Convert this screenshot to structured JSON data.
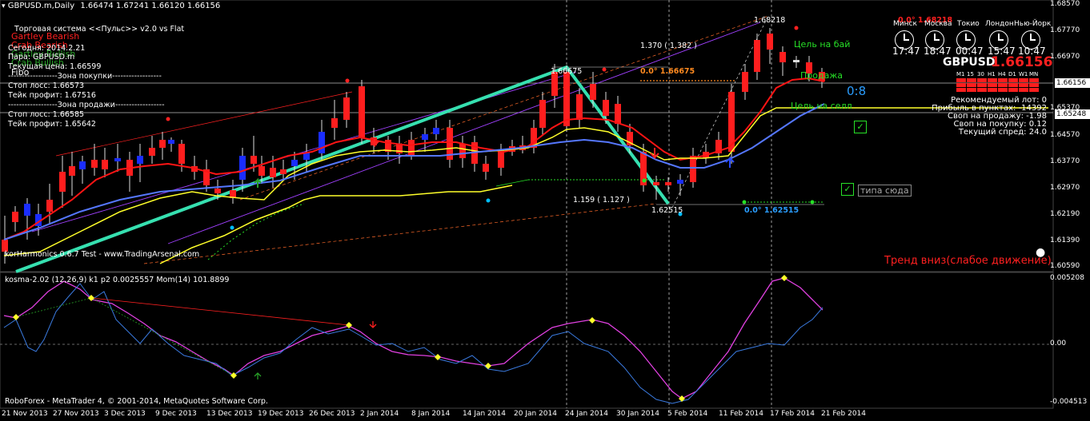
{
  "header": {
    "symbol_timeframe": "GBPUSD.m,Daily",
    "ohlc": "1.66474 1.67241 1.66120 1.66156"
  },
  "left_panel": {
    "title": "Торговая система <<Пульс>> v2.0 vs Flat",
    "harmonic_labels": [
      "Gartley Bearish",
      "Crab Bearish",
      "Gartley Bullish",
      "Crab Bullish",
      "Fibo"
    ],
    "today": "Сегодня:  2014.2.21",
    "pair": "Пара:  GBPUSD.m",
    "current_price": "Текущая цена: 1.66599",
    "buy_zone": "------------------Зона покупки------------------",
    "buy_stop": "Стоп лосс:          1.66573",
    "buy_tp": "Тейк профит:        1.67516",
    "sell_zone": "------------------Зона продажи------------------",
    "sell_stop": "Стоп лосс:          1.66585",
    "sell_tp": "Тейк профит:        1.65642",
    "watermark": "korHarmonics 0.6.7 Test - www.TradingArsenal.com"
  },
  "annotations": {
    "fib_top": "1.68218",
    "fib_top_red": "0.0° 1.68218",
    "fib_mid": "1.370 ( 1.382 )",
    "fib_mid_orange": "0.0° 1.66675",
    "fib_left_top": "1.66675",
    "fib_low_ratio": "1.159 ( 1.127 )",
    "fib_low": "1.62515",
    "fib_low_blue": "0.0° 1.62515",
    "target_buy": "Цель на бай",
    "target_sell": "Цель на селл",
    "sell_label": "Продажа",
    "score": "0:8",
    "tip": "типа сюда",
    "trend": "Тренд вниз(слабое движение)"
  },
  "clock_panel": {
    "cities": [
      "Минск",
      "Москва",
      "Токио",
      "Лондон",
      "Нью-Йорк"
    ],
    "times": [
      "17:47",
      "18:47",
      "00:47",
      "15:47",
      "10:47"
    ],
    "symbol": "GBPUSD",
    "price": "1.66156",
    "timeframes": [
      "M1",
      "15",
      "30",
      "H1",
      "H4",
      "D1",
      "W1",
      "MN"
    ],
    "info": [
      "Рекомендуемый лот: 0",
      "Прибыль в пунктах: -14392",
      "Своп на продажу: -1.98",
      "Своп на покупку: 0.12",
      "Текущий спред: 24.0"
    ]
  },
  "price_axis": [
    "1.68570",
    "1.67770",
    "1.66970",
    "1.66156",
    "1.65370",
    "1.65248",
    "1.64570",
    "1.63770",
    "1.62970",
    "1.62190",
    "1.61390",
    "1.60590"
  ],
  "indicator": {
    "label": "kosma-2.02 (12,26,9) k1 p2 0.0025557  Mom(14) 101.8899",
    "axis": [
      "0.005208",
      "0.00",
      "-0.004513"
    ]
  },
  "footer": {
    "copyright": "RoboForex - MetaTrader 4, © 2001-2014, MetaQuotes Software Corp.",
    "dates": [
      "21 Nov 2013",
      "27 Nov 2013",
      "3 Dec 2013",
      "9 Dec 2013",
      "13 Dec 2013",
      "19 Dec 2013",
      "26 Dec 2013",
      "2 Jan 2014",
      "8 Jan 2014",
      "14 Jan 2014",
      "20 Jan 2014",
      "24 Jan 2014",
      "30 Jan 2014",
      "5 Feb 2014",
      "11 Feb 2014",
      "17 Feb 2014",
      "21 Feb 2014"
    ]
  },
  "colors": {
    "bull": "#1a2dff",
    "bear": "#ff1e1e",
    "ma_red": "#ff1414",
    "ma_yellow": "#ffff2a",
    "ma_blue": "#5577ff",
    "pattern": "#36e0b0"
  }
}
